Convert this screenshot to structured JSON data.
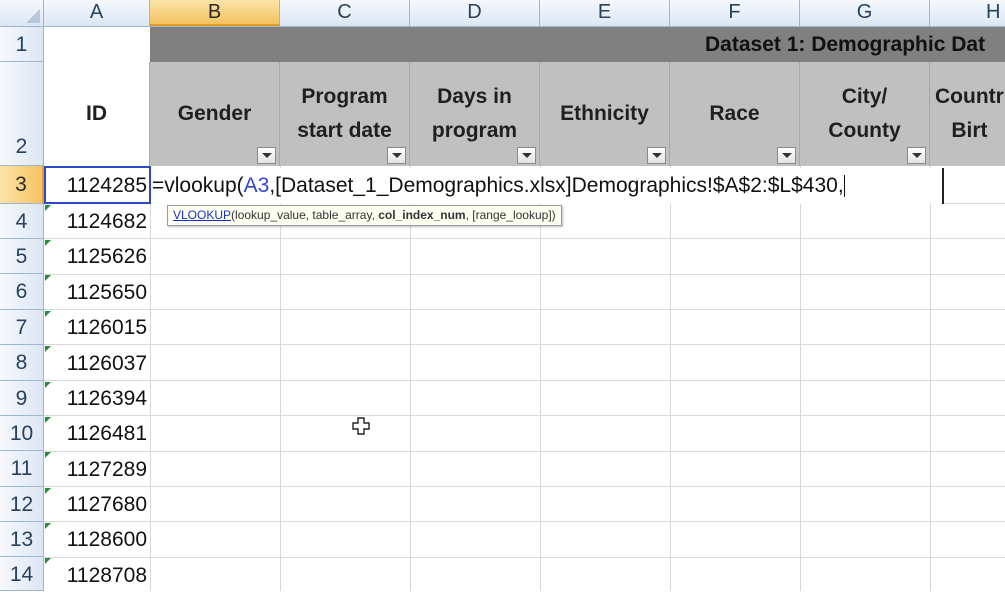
{
  "columns": [
    "A",
    "B",
    "C",
    "D",
    "E",
    "F",
    "G",
    "H"
  ],
  "rows": [
    "1",
    "2",
    "3",
    "4",
    "5",
    "6",
    "7",
    "8",
    "9",
    "10",
    "11",
    "12",
    "13",
    "14"
  ],
  "selected_column": "B",
  "selected_row": "3",
  "banner": {
    "text": "Dataset 1: Demographic Dat"
  },
  "headers": [
    {
      "lines": [
        "ID"
      ]
    },
    {
      "lines": [
        "Gender"
      ]
    },
    {
      "lines": [
        "Program",
        "start date"
      ]
    },
    {
      "lines": [
        "Days in",
        "program"
      ]
    },
    {
      "lines": [
        "Ethnicity"
      ]
    },
    {
      "lines": [
        "Race"
      ]
    },
    {
      "lines": [
        "City/",
        "County"
      ]
    },
    {
      "lines": [
        "Countr",
        "Birt"
      ]
    }
  ],
  "ids": [
    "1124285",
    "1124682",
    "1125626",
    "1125650",
    "1126015",
    "1126037",
    "1126394",
    "1126481",
    "1127289",
    "1127680",
    "1128600",
    "1128708"
  ],
  "formula": {
    "prefix": "=vlookup(",
    "ref": "A3",
    "rest": ",[Dataset_1_Demographics.xlsx]Demographics!$A$2:$L$430,"
  },
  "tooltip": {
    "function": "VLOOKUP",
    "open": "(",
    "arg1": "lookup_value, table_array, ",
    "current_arg": "col_index_num",
    "arg_rest": ", [range_lookup])"
  },
  "icons": {
    "pointer": "cross-cursor-icon",
    "filter": "filter-dropdown-icon"
  },
  "colors": {
    "banner": "#808080",
    "header_fill": "#c0c0c0",
    "selection": "#f4c35f",
    "reference": "#2d48c9"
  }
}
